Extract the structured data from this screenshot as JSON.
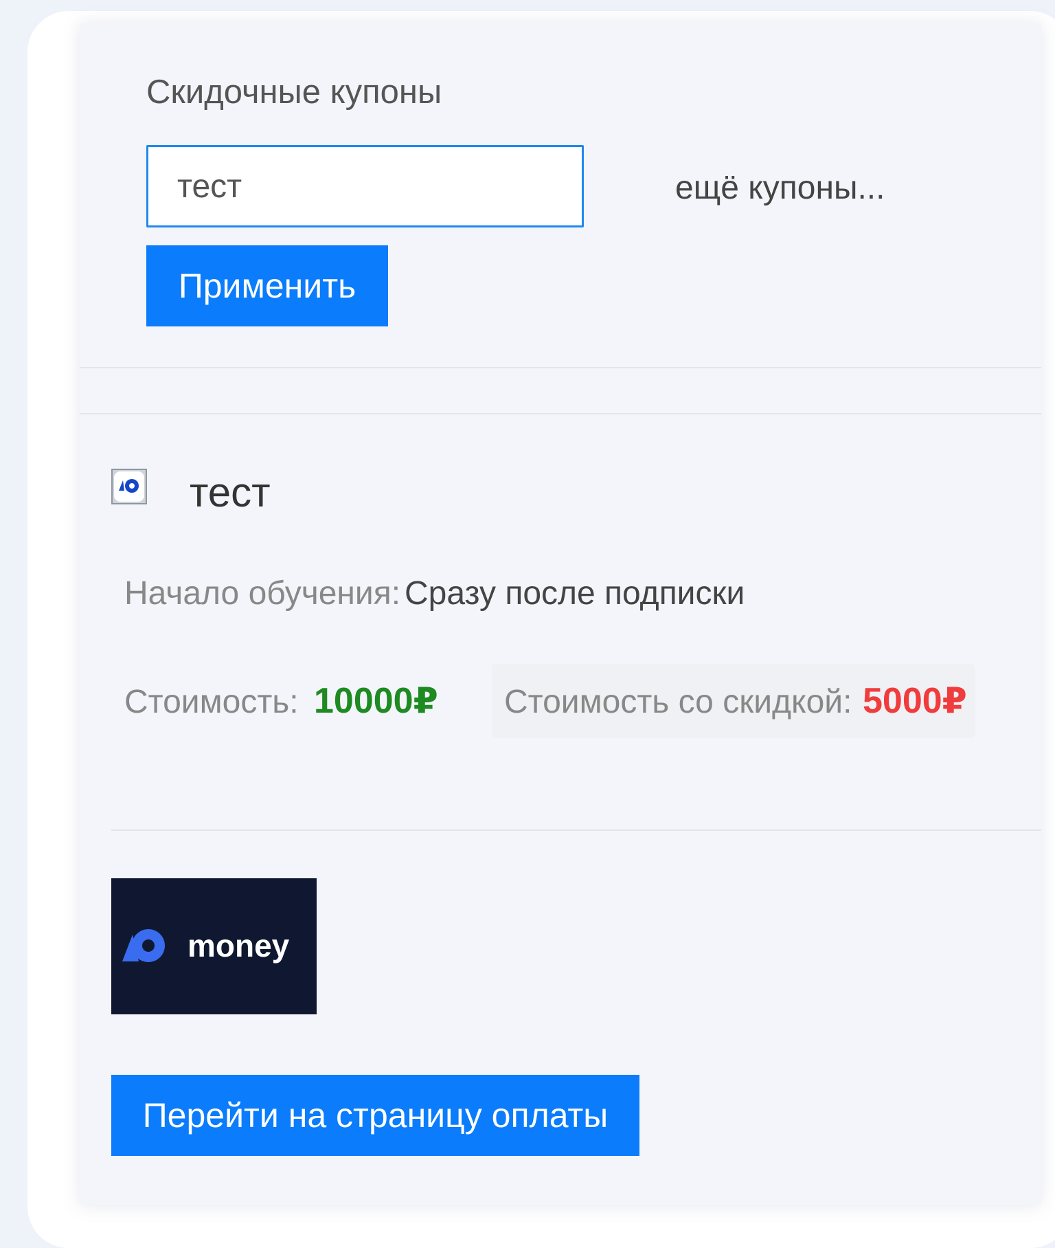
{
  "coupons": {
    "title": "Скидочные купоны",
    "input_value": "тест",
    "more_link": "ещё купоны...",
    "apply_label": "Применить"
  },
  "course": {
    "title": "тест",
    "logo_icon": "yoomoney-logo-icon"
  },
  "details": {
    "start_label": "Начало обучения:",
    "start_value": "Сразу после подписки",
    "price_label": "Стоимость:",
    "price_value": "10000₽",
    "discount_label": "Стоимость со скидкой:",
    "discount_value": "5000₽"
  },
  "payment": {
    "logo_text": "money",
    "button_label": "Перейти на страницу оплаты"
  },
  "colors": {
    "accent": "#0a7cfc",
    "price": "#1e8a22",
    "discount": "#f03c3c",
    "logo_background": "#0f1830"
  }
}
